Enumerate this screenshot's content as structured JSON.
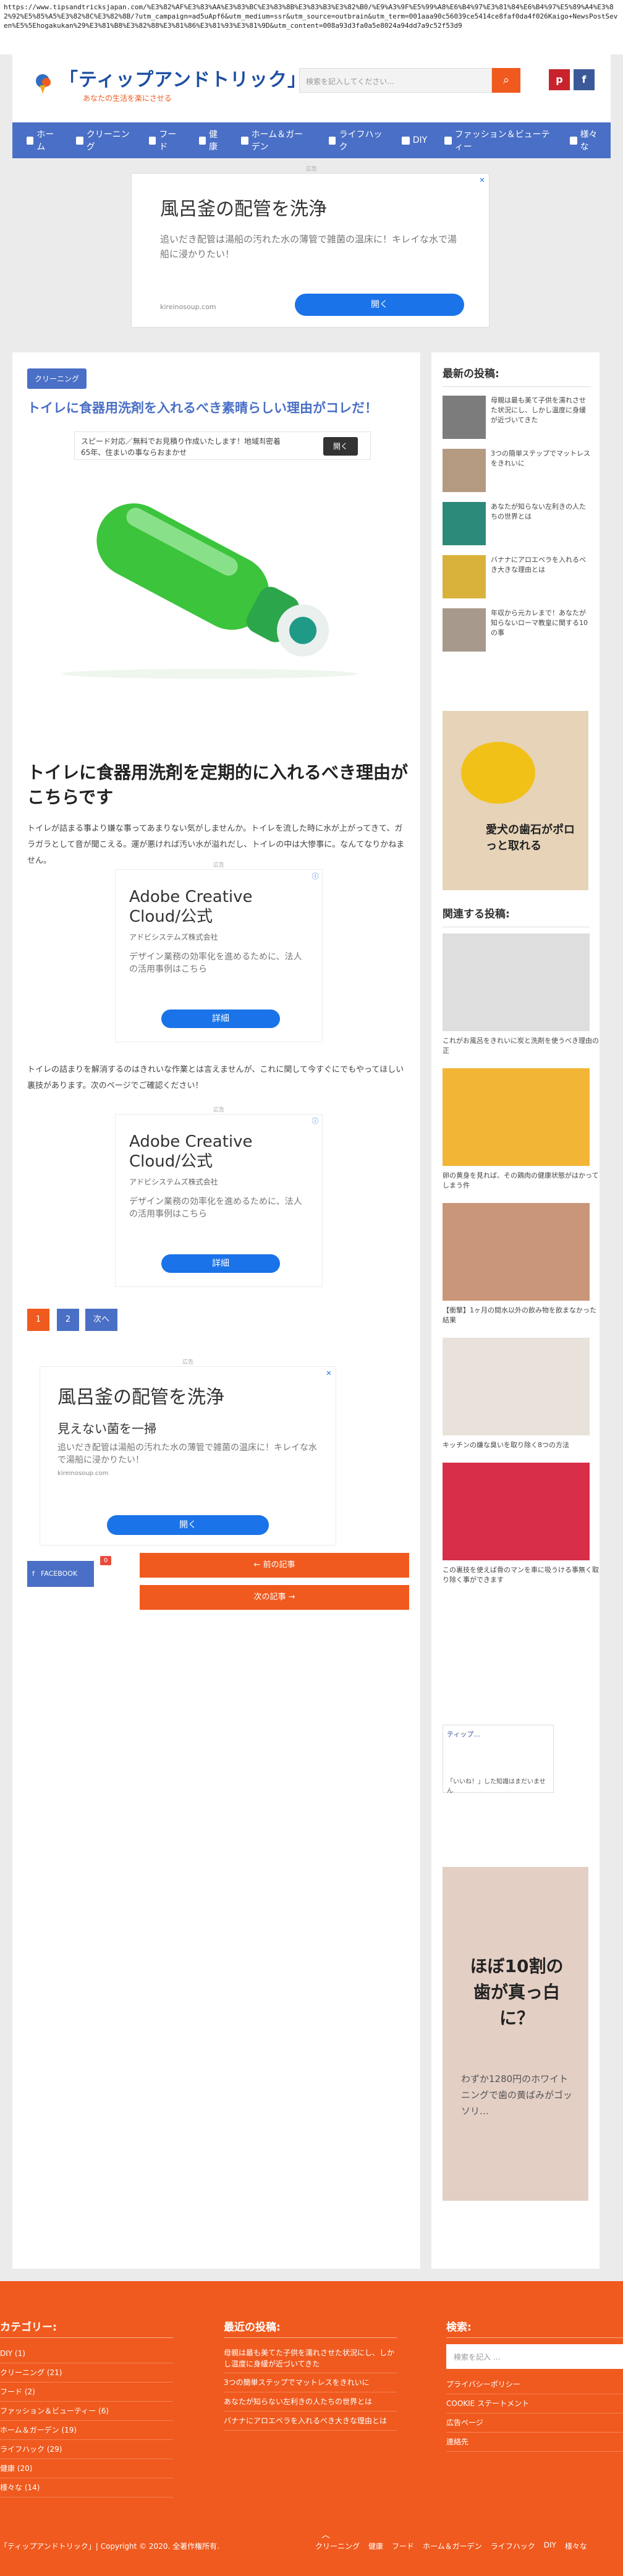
{
  "browser": {
    "url": "https://www.tipsandtricksjapan.com/%E3%82%AF%E3%83%AA%E3%83%BC%E3%83%8B%E3%83%B3%E3%82%B0/%E9%A3%9F%E5%99%A8%E6%B4%97%E3%81%84%E6%B4%97%E5%89%A4%E3%82%92%E5%85%A5%E3%82%8C%E3%82%8B/?utm_campaign=ad5uApf6&utm_medium=ssr&utm_source=outbrain&utm_term=001aaa90c56039ce5414ce8faf0da4f026Kaigo+NewsPostSeven%E5%5Ehogakukan%29%E3%81%B8%E3%82%88%E3%81%86%E3%81%93%E3%81%9D&utm_content=008a93d3fa0a5e8024a94dd7a9c52f53d9"
  },
  "header": {
    "logo_title": "「ティップアンドトリック」",
    "logo_sub": "あなたの生活を楽にさせる",
    "search_placeholder": "検索を記入してください...",
    "search_icon": "search-icon",
    "pinterest": "p",
    "facebook": "f"
  },
  "nav": [
    {
      "label": "ホーム",
      "icon": "home-icon"
    },
    {
      "label": "クリーニング",
      "icon": "cleaning-icon"
    },
    {
      "label": "フード",
      "icon": "food-icon"
    },
    {
      "label": "健康",
      "icon": "heart-icon"
    },
    {
      "label": "ホーム＆ガーデン",
      "icon": "garden-icon"
    },
    {
      "label": "ライフハック",
      "icon": "lifehack-icon"
    },
    {
      "label": "DIY",
      "icon": "diy-icon"
    },
    {
      "label": "ファッション＆ビューティー",
      "icon": "fashion-icon"
    },
    {
      "label": "様々な",
      "icon": "star-icon"
    }
  ],
  "ads": {
    "label": "広告",
    "top_title": "風呂釜の配管を洗浄",
    "top_text": "追いだき配管は湯船の汚れた水の薄管で雑菌の温床に！キレイな水で湯船に浸かりたい！",
    "top_domain": "kireinosoup.com",
    "top_btn": "開く",
    "small_text": "スピード対応／無料でお見積り作成いたします！地域최密着65年、住まいの事ならおまかせ",
    "small_btn": "開く",
    "mid_title": "Adobe Creative Cloud/公式",
    "mid_company": "アドビシステムズ株式会社",
    "mid_text": "デザイン業務の効率化を進めるために、法人の活用事例はこちら",
    "mid_btn": "詳細",
    "big_title": "風呂釜の配管を洗浄",
    "big_sub": "見えない菌を一掃",
    "big_text": "追いだき配管は湯船の汚れた水の薄管で雑菌の温床に！キレイな水で湯船に浸かりたい！",
    "big_domain": "kireinosoup.com",
    "big_btn": "開く"
  },
  "article": {
    "category": "クリーニング",
    "title": "トイレに食器用洗剤を入れるべき素晴らしい理由がコレだ！",
    "heading": "トイレに食器用洗剤を定期的に入れるべき理由がこちらです",
    "para1": "トイレが詰まる事より嫌な事ってあまりない気がしませんか。トイレを流した時に水が上がってきて、ガラガラとして音が聞こえる。運が悪ければ汚い水が溢れだし、トイレの中は大惨事に。なんてなりかねません。",
    "para2": "トイレの詰まりを解消するのはきれいな作業とは言えませんが、これに関して今すぐにでもやってほしい裏技があります。次のページでご確認ください！",
    "page1": "1",
    "page2": "2",
    "next": "次へ",
    "fb_share": "FACEBOOK",
    "fb_count": "0",
    "prev_post": "← 前の記事",
    "next_post": "次の記事 →"
  },
  "sidebar": {
    "recent_title": "最新の投稿:",
    "recent": [
      "母親は最も美て子供を濡れさせた状況にし、しかし温度に身緩が近づいてきた",
      "3つの簡単ステップでマットレスをきれいに",
      "あなたが知らない左利きの人たちの世界とは",
      "バナナにアロエベラを入れるべき大きな理由とは",
      "年収から元カレまで！あなたが知らないローマ教皇に関する10の事"
    ],
    "ad_text": "愛犬の歯石がポロっと取れる",
    "related_title": "関連する投稿:",
    "related": [
      "これがお風呂をきれいに炭と洗剤を使うべき理由の正",
      "卵の黄身を見れば、その鶏肉の健康状態がはかってしまう件",
      "【衝撃】1ヶ月の間水以外の飲み物を飲まなかった結果",
      "キッチンの嫌な臭いを取り除く8つの方法",
      "この裏技を使えば骨のマンを車に吸うける事無く取り除く事ができます"
    ],
    "fb_widget_title": "ティップ...",
    "fb_widget_text": "「いいね！」した知識はまだいません",
    "ad2_text": "ほぼ10割の歯が真っ白に？",
    "ad2_sub": "わずか1280円のホワイトニングで歯の黄ばみがゴッソリ…"
  },
  "footer": {
    "cat_title": "カテゴリー:",
    "cats": [
      "DIY (1)",
      "クリーニング (21)",
      "フード (2)",
      "ファッション＆ビューティー (6)",
      "ホーム＆ガーデン (19)",
      "ライフハック (29)",
      "健康 (20)",
      "様々な (14)"
    ],
    "recent_title": "最近の投稿:",
    "recent": [
      "母親は最も美てた子供を濡れさせた状況にし、しかし温度に身緩が近づいてきた",
      "3つの簡単ステップでマットレスをきれいに",
      "あなたが知らない左利きの人たちの世界とは",
      "バナナにアロエベラを入れるべき大きな理由とは"
    ],
    "search_title": "検索:",
    "search_placeholder": "検索を記入 ...",
    "links": [
      "プライバシーポリシー",
      "COOKIE ステートメント",
      "広告ページ",
      "連絡先"
    ],
    "copyright": "「ティップアンドトリック」| Copyright © 2020. 全著作権所有.",
    "fnav": [
      "クリーニング",
      "健康",
      "フード",
      "ホーム＆ガーデン",
      "ライフハック",
      "DIY",
      "様々な"
    ]
  }
}
